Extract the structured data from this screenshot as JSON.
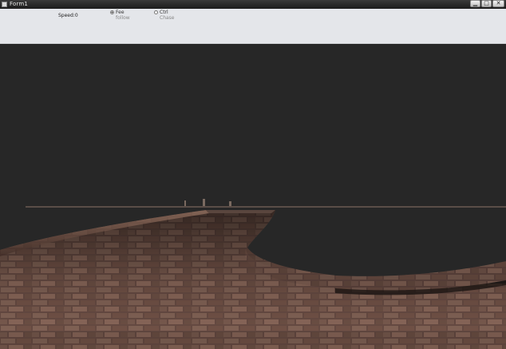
{
  "window": {
    "title": "Form1",
    "min_glyph": "▁",
    "max_glyph": "□",
    "close_glyph": "✕"
  },
  "toolbar": {
    "speed_label": "Speed:0",
    "group1": {
      "option1": "Fee",
      "option2": "follow"
    },
    "group2": {
      "option1": "Ctrl",
      "option2": "Chase"
    }
  },
  "colors": {
    "titlebar": "#1c1c1c",
    "toolbar_bg": "#e4e6ea",
    "viewport_bg": "#272727",
    "brick_light": "#8a6a5c",
    "brick_dark": "#4a3028"
  },
  "icons": {
    "app": "app-icon",
    "minimize": "minimize-icon",
    "maximize": "maximize-icon",
    "close": "close-icon"
  }
}
